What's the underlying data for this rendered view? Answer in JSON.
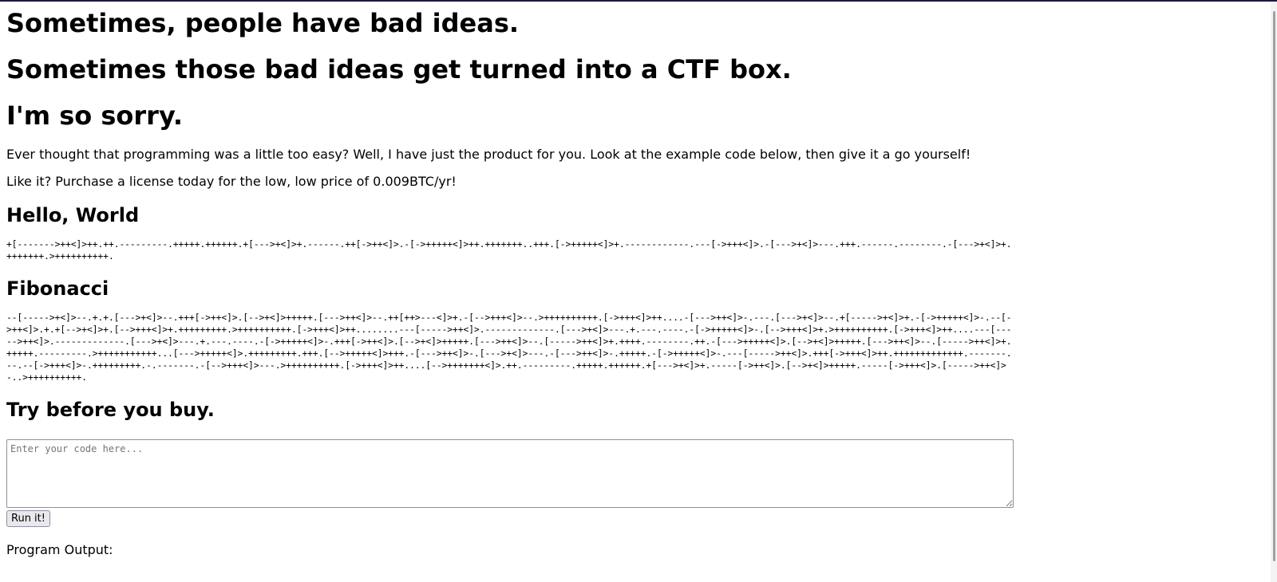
{
  "headings": {
    "line1": "Sometimes, people have bad ideas.",
    "line2": "Sometimes those bad ideas get turned into a CTF box.",
    "line3": "I'm so sorry."
  },
  "intro": {
    "paragraph1": "Ever thought that programming was a little too easy? Well, I have just the product for you. Look at the example code below, then give it a go yourself!",
    "paragraph2": "Like it? Purchase a license today for the low, low price of 0.009BTC/yr!"
  },
  "examples": {
    "hello": {
      "title": "Hello, World",
      "code": "+[------->++<]>++.++.---------.+++++.++++++.+[--->+<]>+.------.++[->++<]>.-[->+++++<]>++.+++++++..+++.[->+++++<]>+.------------.---[->+++<]>.-[--->+<]>---.+++.------.--------.-[--->+<]>+.+++++++.>++++++++++."
    },
    "fibonacci": {
      "title": "Fibonacci",
      "code": "--[----->+<]>--.+.+.[--->+<]>--.+++[->++<]>.[-->+<]>+++++.[--->++<]>--.++[++>---<]>+.-[-->+++<]>--.>++++++++++.[->+++<]>++....-[--->++<]>-.---.[--->+<]>--.+[----->+<]>+.-[->+++++<]>-.--[->++<]>.+.+[-->+<]>+.[-->+++<]>+.+++++++++.>++++++++++.[->+++<]>++........---[----->++<]>.-------------.[--->+<]>---.+.---.----.-[->+++++<]>-.[-->+++<]>+.>++++++++++.[->+++<]>++....---[----->++<]>.-------------.[--->+<]>---.+.---.----.-[->+++++<]>-.+++[->++<]>.[-->+<]>+++++.[--->++<]>--.[----->++<]>+.++++.--------.++.-[--->+++++<]>.[-->+<]>+++++.[--->++<]>--.[----->++<]>+.+++++.---------.>+++++++++++...[--->+++++<]>.+++++++++.+++.[-->+++++<]>+++.-[--->++<]>-.[--->+<]>---.-[--->++<]>-.+++++.-[->+++++<]>-.---[----->++<]>.+++[->+++<]>++.+++++++++++++.-------.--.--[->+++<]>-.+++++++++.-.-------.-[-->+++<]>---.>++++++++++.[->+++<]>++....[-->+++++++<]>.++.---------.+++++.++++++.+[--->+<]>+.-----[->++<]>.[-->+<]>+++++.-----[->+++<]>.[----->++<]>-..>++++++++++."
    }
  },
  "try": {
    "title": "Try before you buy.",
    "placeholder": "Enter your code here...",
    "run_label": "Run it!",
    "output_label": "Program Output:"
  }
}
